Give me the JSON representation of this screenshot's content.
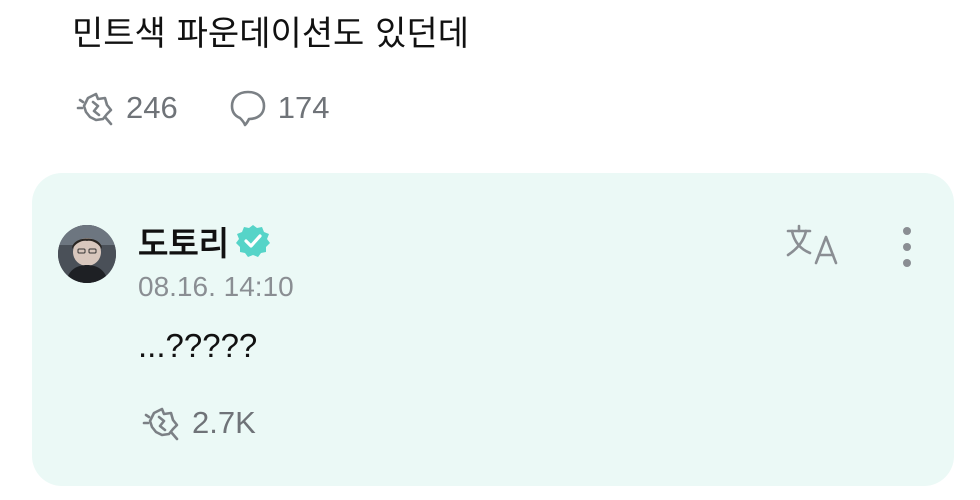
{
  "post": {
    "text": "민트색 파운데이션도 있던데",
    "like_count": "246",
    "comment_count": "174",
    "like_icon": "cheer-hand-icon",
    "comment_icon": "speech-bubble-icon"
  },
  "reply": {
    "author": "도토리",
    "verified_icon": "verified-badge-icon",
    "timestamp": "08.16. 14:10",
    "text": "...?????",
    "like_count": "2.7K",
    "translate_icon": "translate-icon",
    "more_icon": "more-vertical-icon"
  },
  "colors": {
    "card_background": "#ebf9f6",
    "verified_accent": "#56d4c8",
    "muted_text": "#6f7378",
    "icon_gray": "#8a8e93"
  }
}
